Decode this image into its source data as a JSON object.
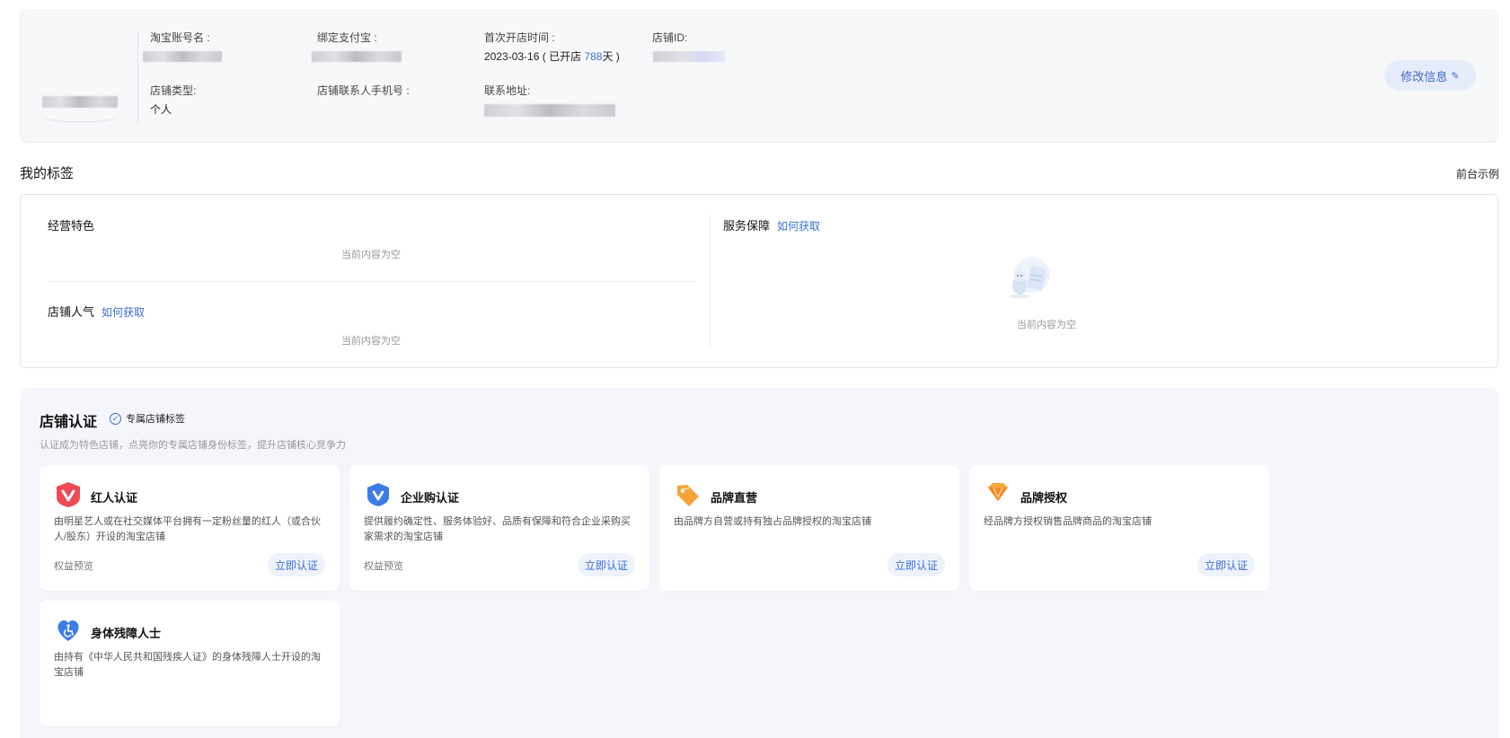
{
  "shop_info": {
    "taobao_account_label": "淘宝账号名 :",
    "alipay_label": "绑定支付宝 :",
    "first_open_label": "首次开店时间 :",
    "first_open_date": "2023-03-16",
    "open_prefix": "( 已开店",
    "open_days": "788",
    "open_suffix": "天 )",
    "shop_id_label": "店铺ID:",
    "shop_type_label": "店铺类型:",
    "shop_type_value": "个人",
    "phone_label": "店铺联系人手机号 :",
    "address_label": "联系地址:",
    "edit_label": "修改信息"
  },
  "tags": {
    "section_title": "我的标签",
    "frontend_example": "前台示例",
    "business_features": "经营特色",
    "shop_popularity": "店铺人气",
    "service_guarantee": "服务保障",
    "how_to_get": "如何获取",
    "empty_text": "当前内容为空"
  },
  "certification": {
    "title": "店铺认证",
    "badge": "专属店铺标签",
    "subtitle": "认证成为特色店铺，点亮你的专属店铺身份标签，提升店铺核心竞争力",
    "cards": [
      {
        "name": "红人认证",
        "desc": "由明星艺人或在社交媒体平台拥有一定粉丝量的红人（或合伙人/股东）开设的淘宝店铺",
        "preview": "权益预览",
        "action": "立即认证",
        "icon": "red-v-shield-icon",
        "color": "#f04a55"
      },
      {
        "name": "企业购认证",
        "desc": "提供履约确定性、服务体验好、品质有保障和符合企业采购买家需求的淘宝店铺",
        "preview": "权益预览",
        "action": "立即认证",
        "icon": "blue-v-shield-icon",
        "color": "#3d7be8"
      },
      {
        "name": "品牌直营",
        "desc": "由品牌方自营或持有独占品牌授权的淘宝店铺",
        "preview": "",
        "action": "立即认证",
        "icon": "orange-tag-icon",
        "color": "#f5a336"
      },
      {
        "name": "品牌授权",
        "desc": "经品牌方授权销售品牌商品的淘宝店铺",
        "preview": "",
        "action": "立即认证",
        "icon": "orange-diamond-icon",
        "color": "#f6a63a"
      },
      {
        "name": "身体残障人士",
        "desc": "由持有《中华人民共和国残疾人证》的身体残障人士开设的淘宝店铺",
        "preview": "",
        "action": "",
        "icon": "blue-heart-accessibility-icon",
        "color": "#3d7be8"
      }
    ]
  }
}
